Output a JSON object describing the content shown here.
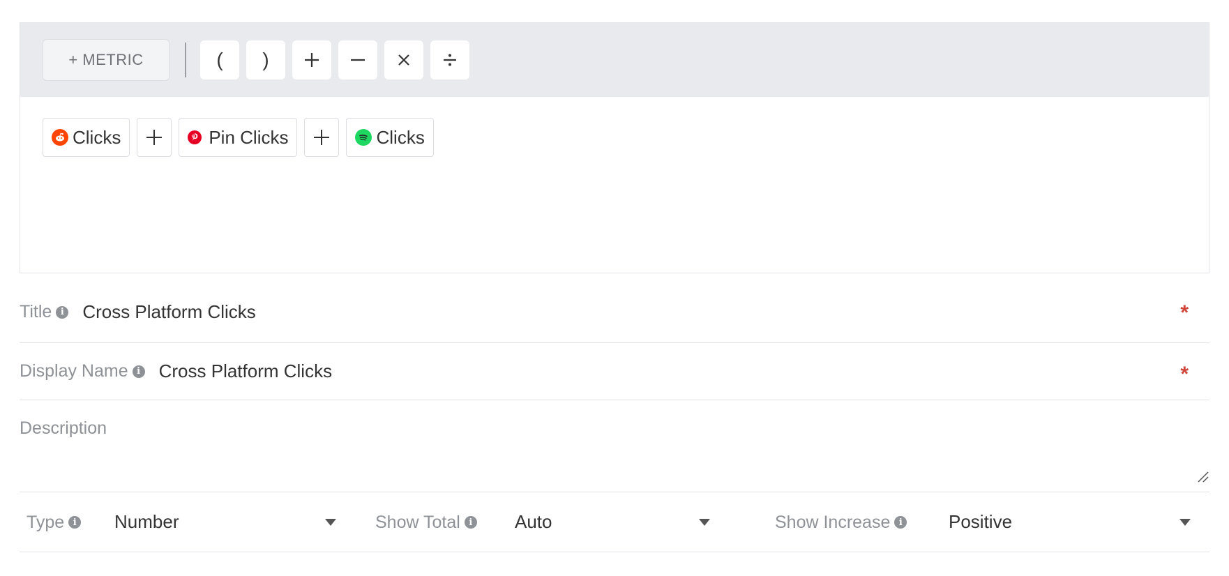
{
  "toolbar": {
    "metric_label": "+ METRIC",
    "operators": [
      "(",
      ")",
      "+",
      "−",
      "×",
      "÷"
    ]
  },
  "formula": {
    "tokens": [
      {
        "label": "Clicks",
        "icon": "reddit-icon",
        "color": "#ff4500"
      },
      {
        "label": "Pin Clicks",
        "icon": "pinterest-icon",
        "color": "#e60023"
      },
      {
        "label": "Clicks",
        "icon": "spotify-icon",
        "color": "#1ed760"
      }
    ]
  },
  "fields": {
    "title_label": "Title",
    "title_value": "Cross Platform Clicks",
    "display_name_label": "Display Name",
    "display_name_value": "Cross Platform Clicks",
    "description_placeholder": "Description",
    "required_mark": "*"
  },
  "selects": {
    "type_label": "Type",
    "type_value": "Number",
    "show_total_label": "Show Total",
    "show_total_value": "Auto",
    "show_increase_label": "Show Increase",
    "show_increase_value": "Positive"
  }
}
